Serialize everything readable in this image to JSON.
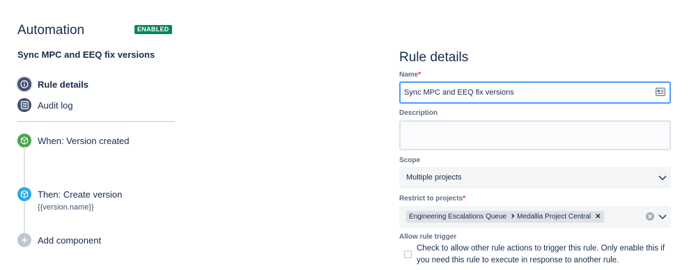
{
  "header": {
    "title": "Automation",
    "status_badge": "ENABLED"
  },
  "rule": {
    "name": "Sync MPC and EEQ fix versions"
  },
  "nav": {
    "rule_details": "Rule details",
    "audit_log": "Audit log"
  },
  "components": {
    "trigger": "When: Version created",
    "action": "Then: Create version",
    "action_detail": "{{version.name}}",
    "add": "Add component"
  },
  "form": {
    "section_title": "Rule details",
    "name_label": "Name",
    "name_value": "Sync MPC and EEQ fix versions",
    "description_label": "Description",
    "description_value": "",
    "scope_label": "Scope",
    "scope_value": "Multiple projects",
    "restrict_label": "Restrict to projects",
    "restrict_tags": [
      "Engineering Escalations Queue",
      "Medallia Project Central"
    ],
    "allow_trigger_label": "Allow rule trigger",
    "allow_trigger_text": "Check to allow other rule actions to trigger this rule. Only enable this if you need this rule to execute in response to another rule.",
    "allow_trigger_checked": false,
    "required_marker": "*"
  },
  "icons": {
    "info": "info-icon",
    "audit": "list-icon",
    "trigger": "cube-icon",
    "action": "cube-icon",
    "add": "plus-icon",
    "chevron": "chevron-down-icon",
    "clear": "clear-icon",
    "field_card": "contact-card-icon"
  },
  "colors": {
    "badge": "#00875a",
    "nav_icon": "#42526e",
    "trigger_icon": "#4ca54c",
    "action_icon": "#2fa7e4",
    "add_icon": "#c1c7d0",
    "focus_border": "#4c9aff"
  }
}
